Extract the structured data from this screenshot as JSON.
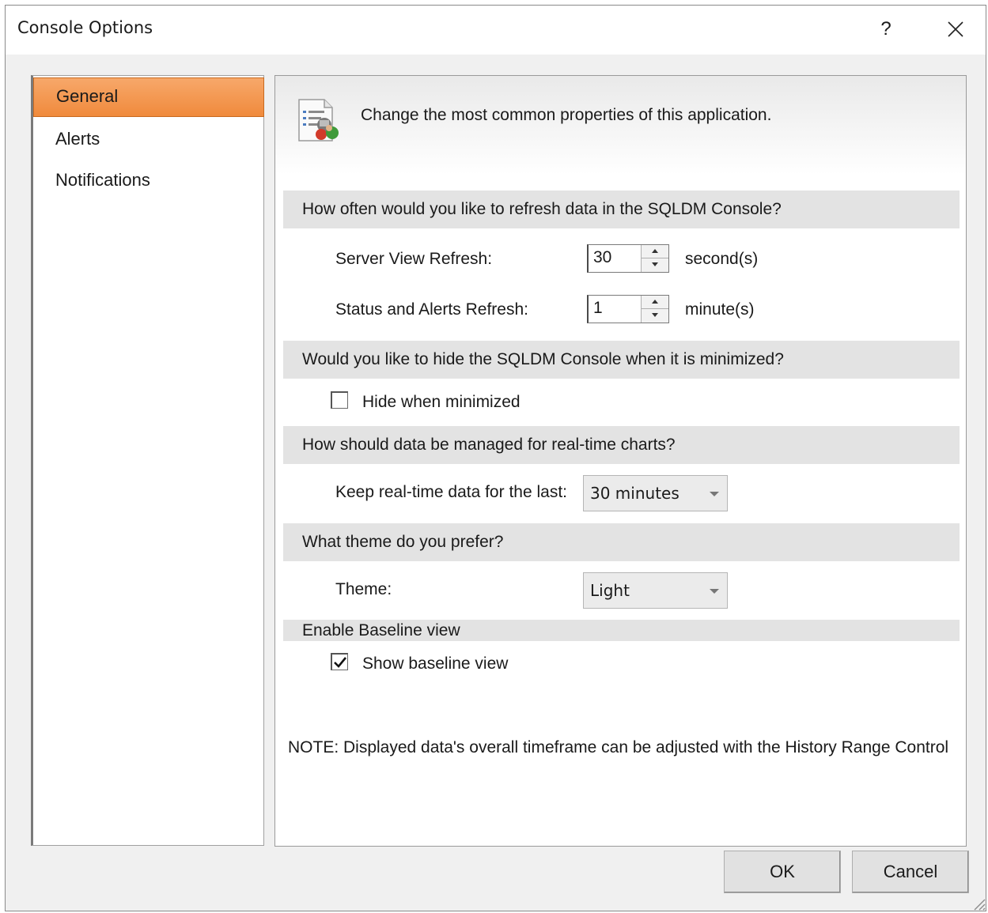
{
  "window": {
    "title": "Console Options",
    "help_label": "?"
  },
  "nav": {
    "items": [
      {
        "label": "General",
        "selected": true
      },
      {
        "label": "Alerts",
        "selected": false
      },
      {
        "label": "Notifications",
        "selected": false
      }
    ]
  },
  "header": {
    "text": "Change the most common properties of this application.",
    "icon": "properties-document-icon"
  },
  "refresh": {
    "section_title": "How often would you like to refresh data in the SQLDM Console?",
    "server_view_label": "Server View Refresh:",
    "server_view_value": "30",
    "server_view_unit": "second(s)",
    "status_alerts_label": "Status and Alerts Refresh:",
    "status_alerts_value": "1",
    "status_alerts_unit": "minute(s)"
  },
  "minimize": {
    "section_title": "Would you like to hide the SQLDM Console when it is minimized?",
    "checkbox_label": "Hide when minimized",
    "checked": false
  },
  "realtime": {
    "section_title": "How should data be managed for real-time charts?",
    "keep_label": "Keep real-time data for the last:",
    "keep_value": "30 minutes"
  },
  "theme": {
    "section_title": "What theme do you prefer?",
    "theme_label": "Theme:",
    "theme_value": "Light"
  },
  "baseline": {
    "section_title": "Enable Baseline view",
    "checkbox_label": "Show baseline view",
    "checked": true
  },
  "note": "NOTE:  Displayed data's overall timeframe can be adjusted with the History Range Control",
  "buttons": {
    "ok": "OK",
    "cancel": "Cancel"
  },
  "colors": {
    "selected_nav": "#f08a3c",
    "section_bar": "#e3e3e3"
  }
}
